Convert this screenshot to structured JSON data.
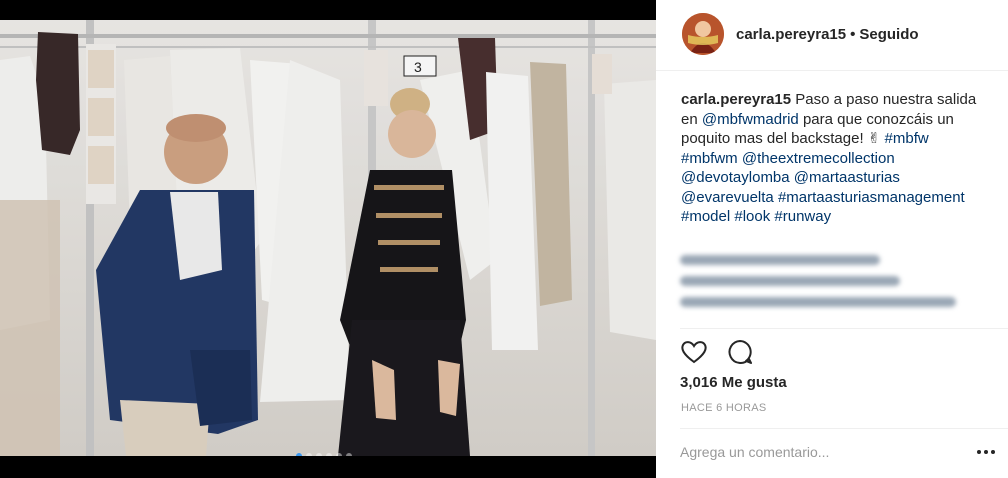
{
  "post": {
    "image_alt": "Backstage photo",
    "carousel_count": 6,
    "carousel_active": 1
  },
  "header": {
    "username": "carla.pereyra15",
    "separator": "•",
    "follow_status": "Seguido"
  },
  "caption": {
    "username": "carla.pereyra15",
    "parts": [
      {
        "type": "text",
        "value": "Paso a paso nuestra salida en "
      },
      {
        "type": "tag",
        "value": "@mbfwmadrid"
      },
      {
        "type": "text",
        "value": " para que conozcáis un poquito mas del backstage! ✌ "
      },
      {
        "type": "tag",
        "value": "#mbfw"
      },
      {
        "type": "text",
        "value": " "
      },
      {
        "type": "tag",
        "value": "#mbfwm"
      },
      {
        "type": "text",
        "value": " "
      },
      {
        "type": "tag",
        "value": "@theextremecollection"
      },
      {
        "type": "text",
        "value": " "
      },
      {
        "type": "tag",
        "value": "@devotaylomba"
      },
      {
        "type": "text",
        "value": " "
      },
      {
        "type": "tag",
        "value": "@martaasturias"
      },
      {
        "type": "text",
        "value": " "
      },
      {
        "type": "tag",
        "value": "@evarevuelta"
      },
      {
        "type": "text",
        "value": " "
      },
      {
        "type": "tag",
        "value": "#martaasturiasmanagement"
      },
      {
        "type": "text",
        "value": " "
      },
      {
        "type": "tag",
        "value": "#model"
      },
      {
        "type": "text",
        "value": " "
      },
      {
        "type": "tag",
        "value": "#look"
      },
      {
        "type": "text",
        "value": " "
      },
      {
        "type": "tag",
        "value": "#runway"
      }
    ]
  },
  "icons": {
    "like": "heart-icon",
    "comment": "comment-icon",
    "more": "more-options-icon"
  },
  "stats": {
    "likes_label": "3,016 Me gusta",
    "time_label": "HACE 6 HORAS"
  },
  "comment": {
    "placeholder": "Agrega un comentario..."
  },
  "colors": {
    "link": "#003569",
    "text": "#262626",
    "muted": "#999999"
  }
}
